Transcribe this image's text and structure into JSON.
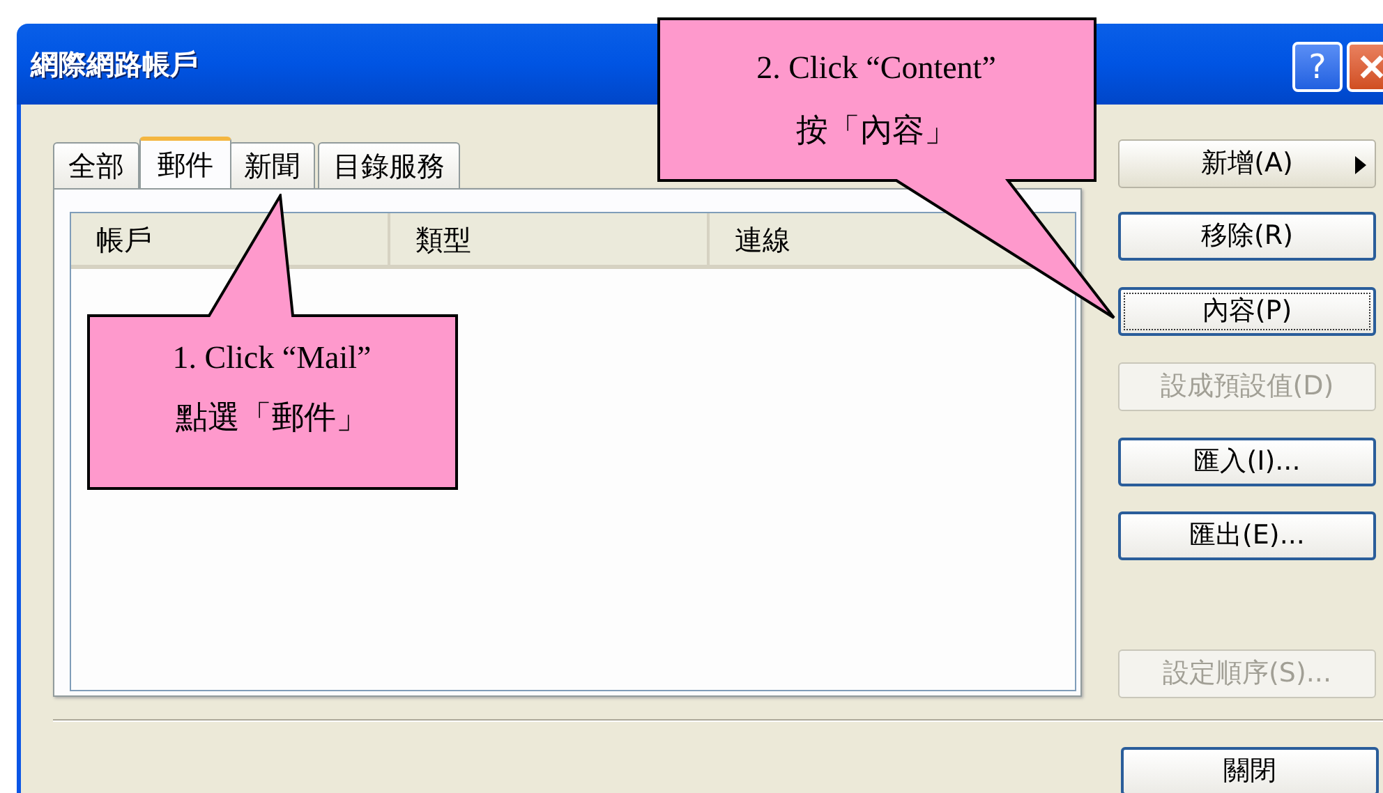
{
  "window": {
    "title": "網際網路帳戶",
    "help_button": "?"
  },
  "tabs": [
    {
      "label": "全部",
      "selected": false
    },
    {
      "label": "郵件",
      "selected": true
    },
    {
      "label": "新聞",
      "selected": false
    },
    {
      "label": "目錄服務",
      "selected": false
    }
  ],
  "list": {
    "columns": [
      "帳戶",
      "類型",
      "連線"
    ]
  },
  "buttons": [
    {
      "label": "新增(A)",
      "kind": "menu",
      "disabled": false,
      "focused": false
    },
    {
      "label": "移除(R)",
      "kind": "push",
      "disabled": false,
      "focused": false
    },
    {
      "label": "內容(P)",
      "kind": "push",
      "disabled": false,
      "focused": true
    },
    {
      "label": "設成預設值(D)",
      "kind": "push",
      "disabled": true,
      "focused": false
    },
    {
      "label": "匯入(I)...",
      "kind": "push",
      "disabled": false,
      "focused": false
    },
    {
      "label": "匯出(E)...",
      "kind": "push",
      "disabled": false,
      "focused": false
    },
    {
      "label": "設定順序(S)...",
      "kind": "push",
      "disabled": true,
      "focused": false
    }
  ],
  "close_button": "關閉",
  "callouts": [
    {
      "lines": [
        "1. Click “Mail”",
        "點選「郵件」"
      ]
    },
    {
      "lines": [
        "2. Click “Content”",
        "按「內容」"
      ]
    }
  ]
}
